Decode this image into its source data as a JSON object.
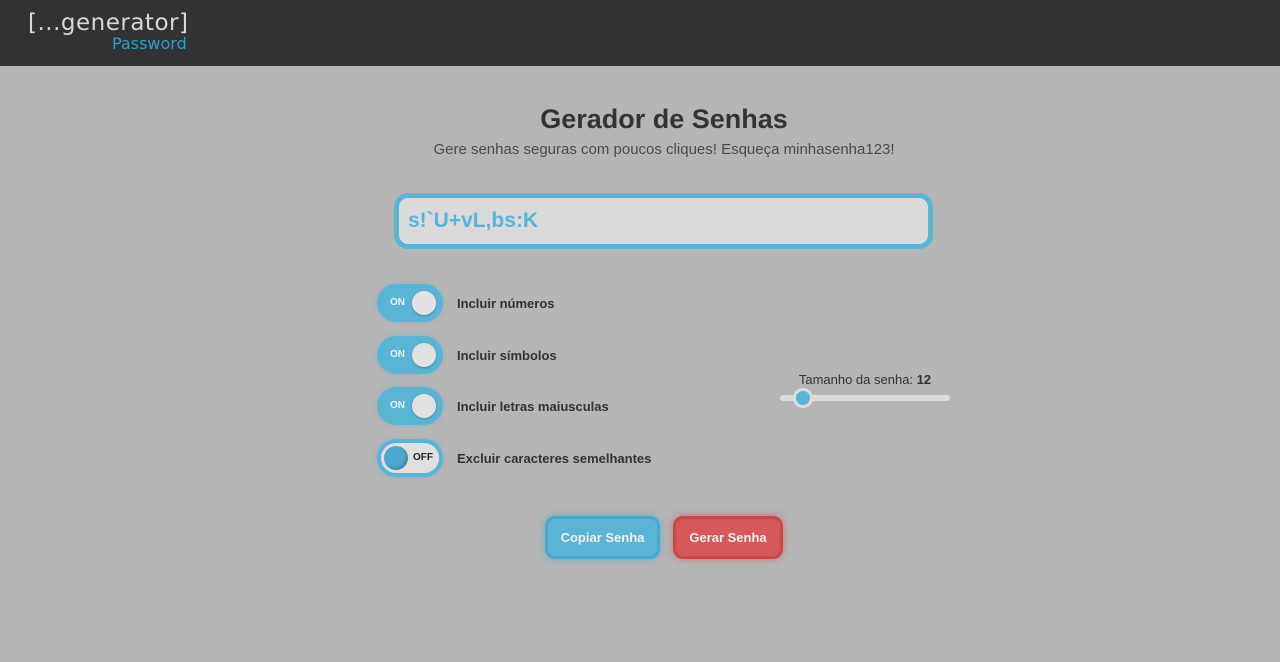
{
  "header": {
    "logo_main": "[...generator]",
    "logo_sub": "Password"
  },
  "main": {
    "title": "Gerador de Senhas",
    "subtitle": "Gere senhas seguras com poucos cliques! Esqueça minhasenha123!",
    "password": "s!`U+vL,bs:K"
  },
  "options": [
    {
      "label": "Incluir números",
      "state": "ON",
      "enabled": true
    },
    {
      "label": "Incluir símbolos",
      "state": "ON",
      "enabled": true
    },
    {
      "label": "Incluir letras maiusculas",
      "state": "ON",
      "enabled": true
    },
    {
      "label": "Excluir caracteres semelhantes",
      "state": "OFF",
      "enabled": false
    }
  ],
  "slider": {
    "label": "Tamanho da senha:",
    "value": "12"
  },
  "buttons": {
    "copy_label": "Copiar Senha",
    "generate_label": "Gerar Senha"
  },
  "colors": {
    "accent": "#5ab5d5",
    "danger": "#d65858",
    "navbar": "#323232",
    "background": "#b5b5b5"
  }
}
